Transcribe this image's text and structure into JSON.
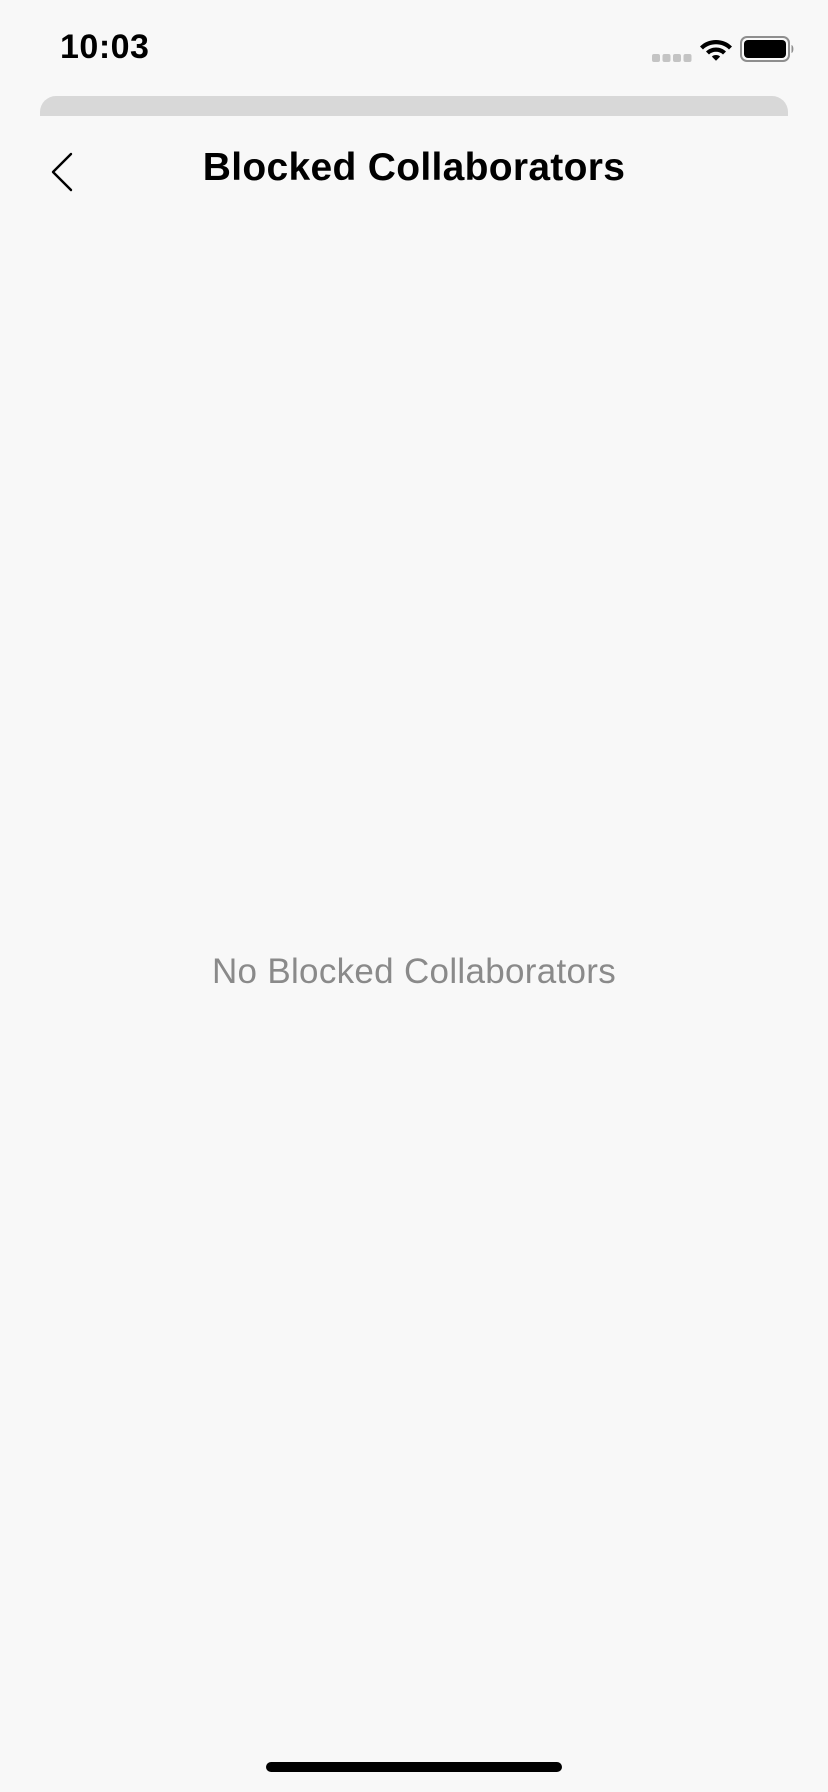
{
  "status_bar": {
    "time": "10:03",
    "icons": [
      "signal-icon",
      "wifi-icon",
      "battery-icon"
    ]
  },
  "nav": {
    "title": "Blocked Collaborators",
    "back_icon": "chevron-left-icon"
  },
  "empty_state": {
    "message": "No Blocked Collaborators"
  },
  "colors": {
    "background": "#f8f8f8",
    "sheet_edge": "#d8d8d8",
    "title": "#000000",
    "empty_text": "#8a8a8a"
  }
}
